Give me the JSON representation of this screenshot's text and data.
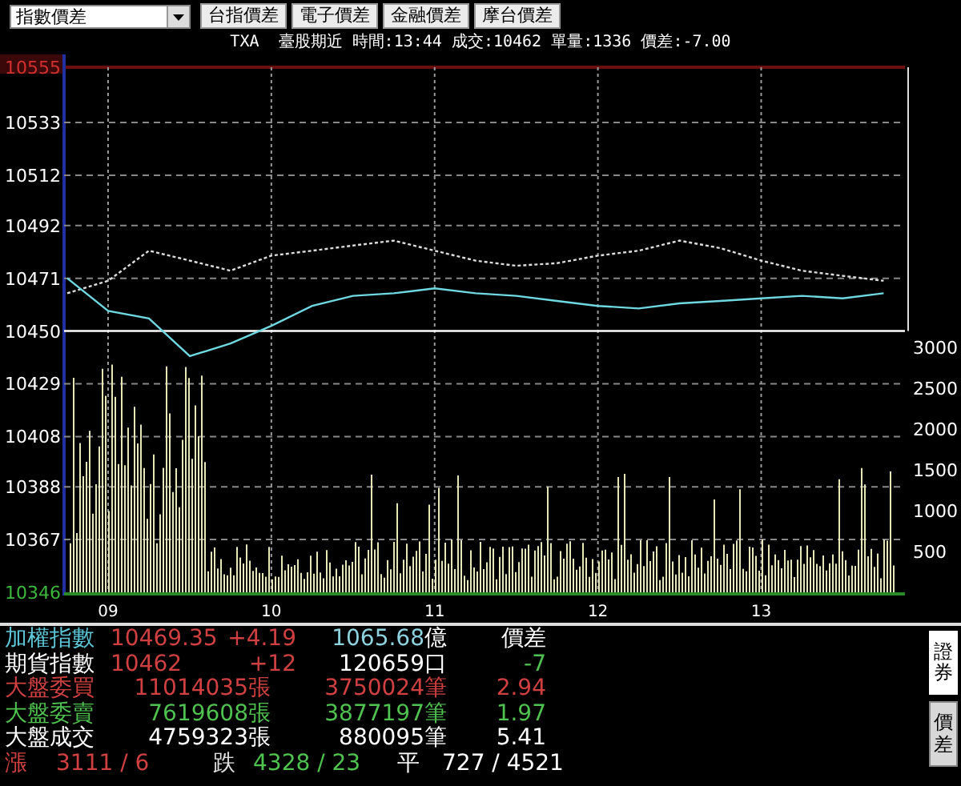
{
  "toolbar": {
    "select": {
      "value": "指數價差"
    },
    "buttons": [
      "台指價差",
      "電子價差",
      "金融價差",
      "摩台價差"
    ]
  },
  "info_line": "TXA  臺股期近 時間:13:44 成交:10462 單量:1336 價差:-7.00",
  "chart": {
    "chart_data": {
      "type": "line",
      "x": [
        8.75,
        9,
        9.25,
        9.5,
        9.75,
        10,
        10.25,
        10.5,
        10.75,
        11,
        11.25,
        11.5,
        11.75,
        12,
        12.25,
        12.5,
        12.75,
        13,
        13.25,
        13.5,
        13.75
      ],
      "grid": true,
      "ref_lines": [
        {
          "axis": "y",
          "value": 10450,
          "color": "#ffffff"
        }
      ],
      "series": [
        {
          "color": "#dddddd",
          "line_style": "dashed",
          "values": [
            10465,
            10470,
            10482,
            10478,
            10474,
            10480,
            10482,
            10484,
            10486,
            10482,
            10478,
            10476,
            10477,
            10480,
            10482,
            10486,
            10483,
            10478,
            10474,
            10472,
            10470
          ]
        },
        {
          "color": "#6fd8e0",
          "line_style": "solid",
          "values": [
            10471,
            10458,
            10455,
            10440,
            10445,
            10452,
            10460,
            10464,
            10465,
            10467,
            10465,
            10464,
            10462,
            10460,
            10459,
            10461,
            10462,
            10463,
            10464,
            10463,
            10465
          ]
        }
      ],
      "ylim": [
        10346,
        10555
      ],
      "yticks": [
        {
          "value": 10555,
          "label": "10555"
        },
        {
          "value": 10533,
          "label": "10533"
        },
        {
          "value": 10512,
          "label": "10512"
        },
        {
          "value": 10492,
          "label": "10492"
        },
        {
          "value": 10471,
          "label": "10471"
        },
        {
          "value": 10450,
          "label": "10450"
        },
        {
          "value": 10429,
          "label": "10429"
        },
        {
          "value": 10408,
          "label": "10408"
        },
        {
          "value": 10388,
          "label": "10388"
        },
        {
          "value": 10367,
          "label": "10367"
        },
        {
          "value": 10346,
          "label": "10346"
        }
      ],
      "xlim": [
        8.75,
        13.9
      ],
      "xticks": [
        {
          "value": 9,
          "label": "09"
        },
        {
          "value": 10,
          "label": "10"
        },
        {
          "value": 11,
          "label": "11"
        },
        {
          "value": 12,
          "label": "12"
        },
        {
          "value": 13,
          "label": "13"
        }
      ]
    },
    "volume_axis": [
      "3000",
      "2500",
      "2000",
      "1500",
      "1000",
      "500"
    ]
  },
  "quote_rows": [
    {
      "kind": "index",
      "cells": [
        {
          "text": "加權指數",
          "color": "#5cc6d6"
        },
        {
          "text": "10469.35",
          "color": "#d04040"
        },
        {
          "text": "+4.19",
          "color": "#d04040"
        },
        {
          "text": "1065.68",
          "color": "#8fd3e0"
        },
        {
          "text": "億",
          "color": "#ffffff"
        },
        {
          "text": "價差",
          "color": "#ffffff"
        }
      ]
    },
    {
      "kind": "index",
      "cells": [
        {
          "text": "期貨指數",
          "color": "#ffffff"
        },
        {
          "text": "10462",
          "color": "#d04040"
        },
        {
          "text": "+12",
          "color": "#d04040"
        },
        {
          "text": "120659",
          "color": "#ffffff"
        },
        {
          "text": "口",
          "color": "#ffffff"
        },
        {
          "text": "-7",
          "color": "#4fc24f"
        }
      ]
    },
    {
      "kind": "volume",
      "cells": [
        {
          "text": "大盤委買",
          "color": "#d04040"
        },
        {
          "text": "11014035",
          "color": "#d04040"
        },
        {
          "text": "張",
          "color": "#d04040"
        },
        {
          "text": "3750024",
          "color": "#d04040"
        },
        {
          "text": "筆",
          "color": "#d04040"
        },
        {
          "text": "2.94",
          "color": "#d04040"
        }
      ]
    },
    {
      "kind": "volume",
      "cells": [
        {
          "text": "大盤委賣",
          "color": "#4fc24f"
        },
        {
          "text": "7619608",
          "color": "#4fc24f"
        },
        {
          "text": "張",
          "color": "#4fc24f"
        },
        {
          "text": "3877197",
          "color": "#4fc24f"
        },
        {
          "text": "筆",
          "color": "#4fc24f"
        },
        {
          "text": "1.97",
          "color": "#4fc24f"
        }
      ]
    },
    {
      "kind": "volume",
      "cells": [
        {
          "text": "大盤成交",
          "color": "#ffffff"
        },
        {
          "text": "4759323",
          "color": "#ffffff"
        },
        {
          "text": "張",
          "color": "#ffffff"
        },
        {
          "text": "880095",
          "color": "#ffffff"
        },
        {
          "text": "筆",
          "color": "#ffffff"
        },
        {
          "text": "5.41",
          "color": "#ffffff"
        }
      ]
    },
    {
      "kind": "breadth",
      "cells": [
        {
          "text": "漲",
          "color": "#d04040"
        },
        {
          "text": "3111 / 6",
          "color": "#d04040"
        },
        {
          "text": "跌",
          "color": "#e0e0e0"
        },
        {
          "text": "4328 / 23",
          "color": "#4fc24f"
        },
        {
          "text": "平",
          "color": "#ffffff"
        },
        {
          "text": "727 / 4521",
          "color": "#ffffff"
        }
      ]
    }
  ],
  "side_tabs": [
    {
      "label": "證券",
      "selected": true
    },
    {
      "label": "價差",
      "selected": false
    }
  ]
}
